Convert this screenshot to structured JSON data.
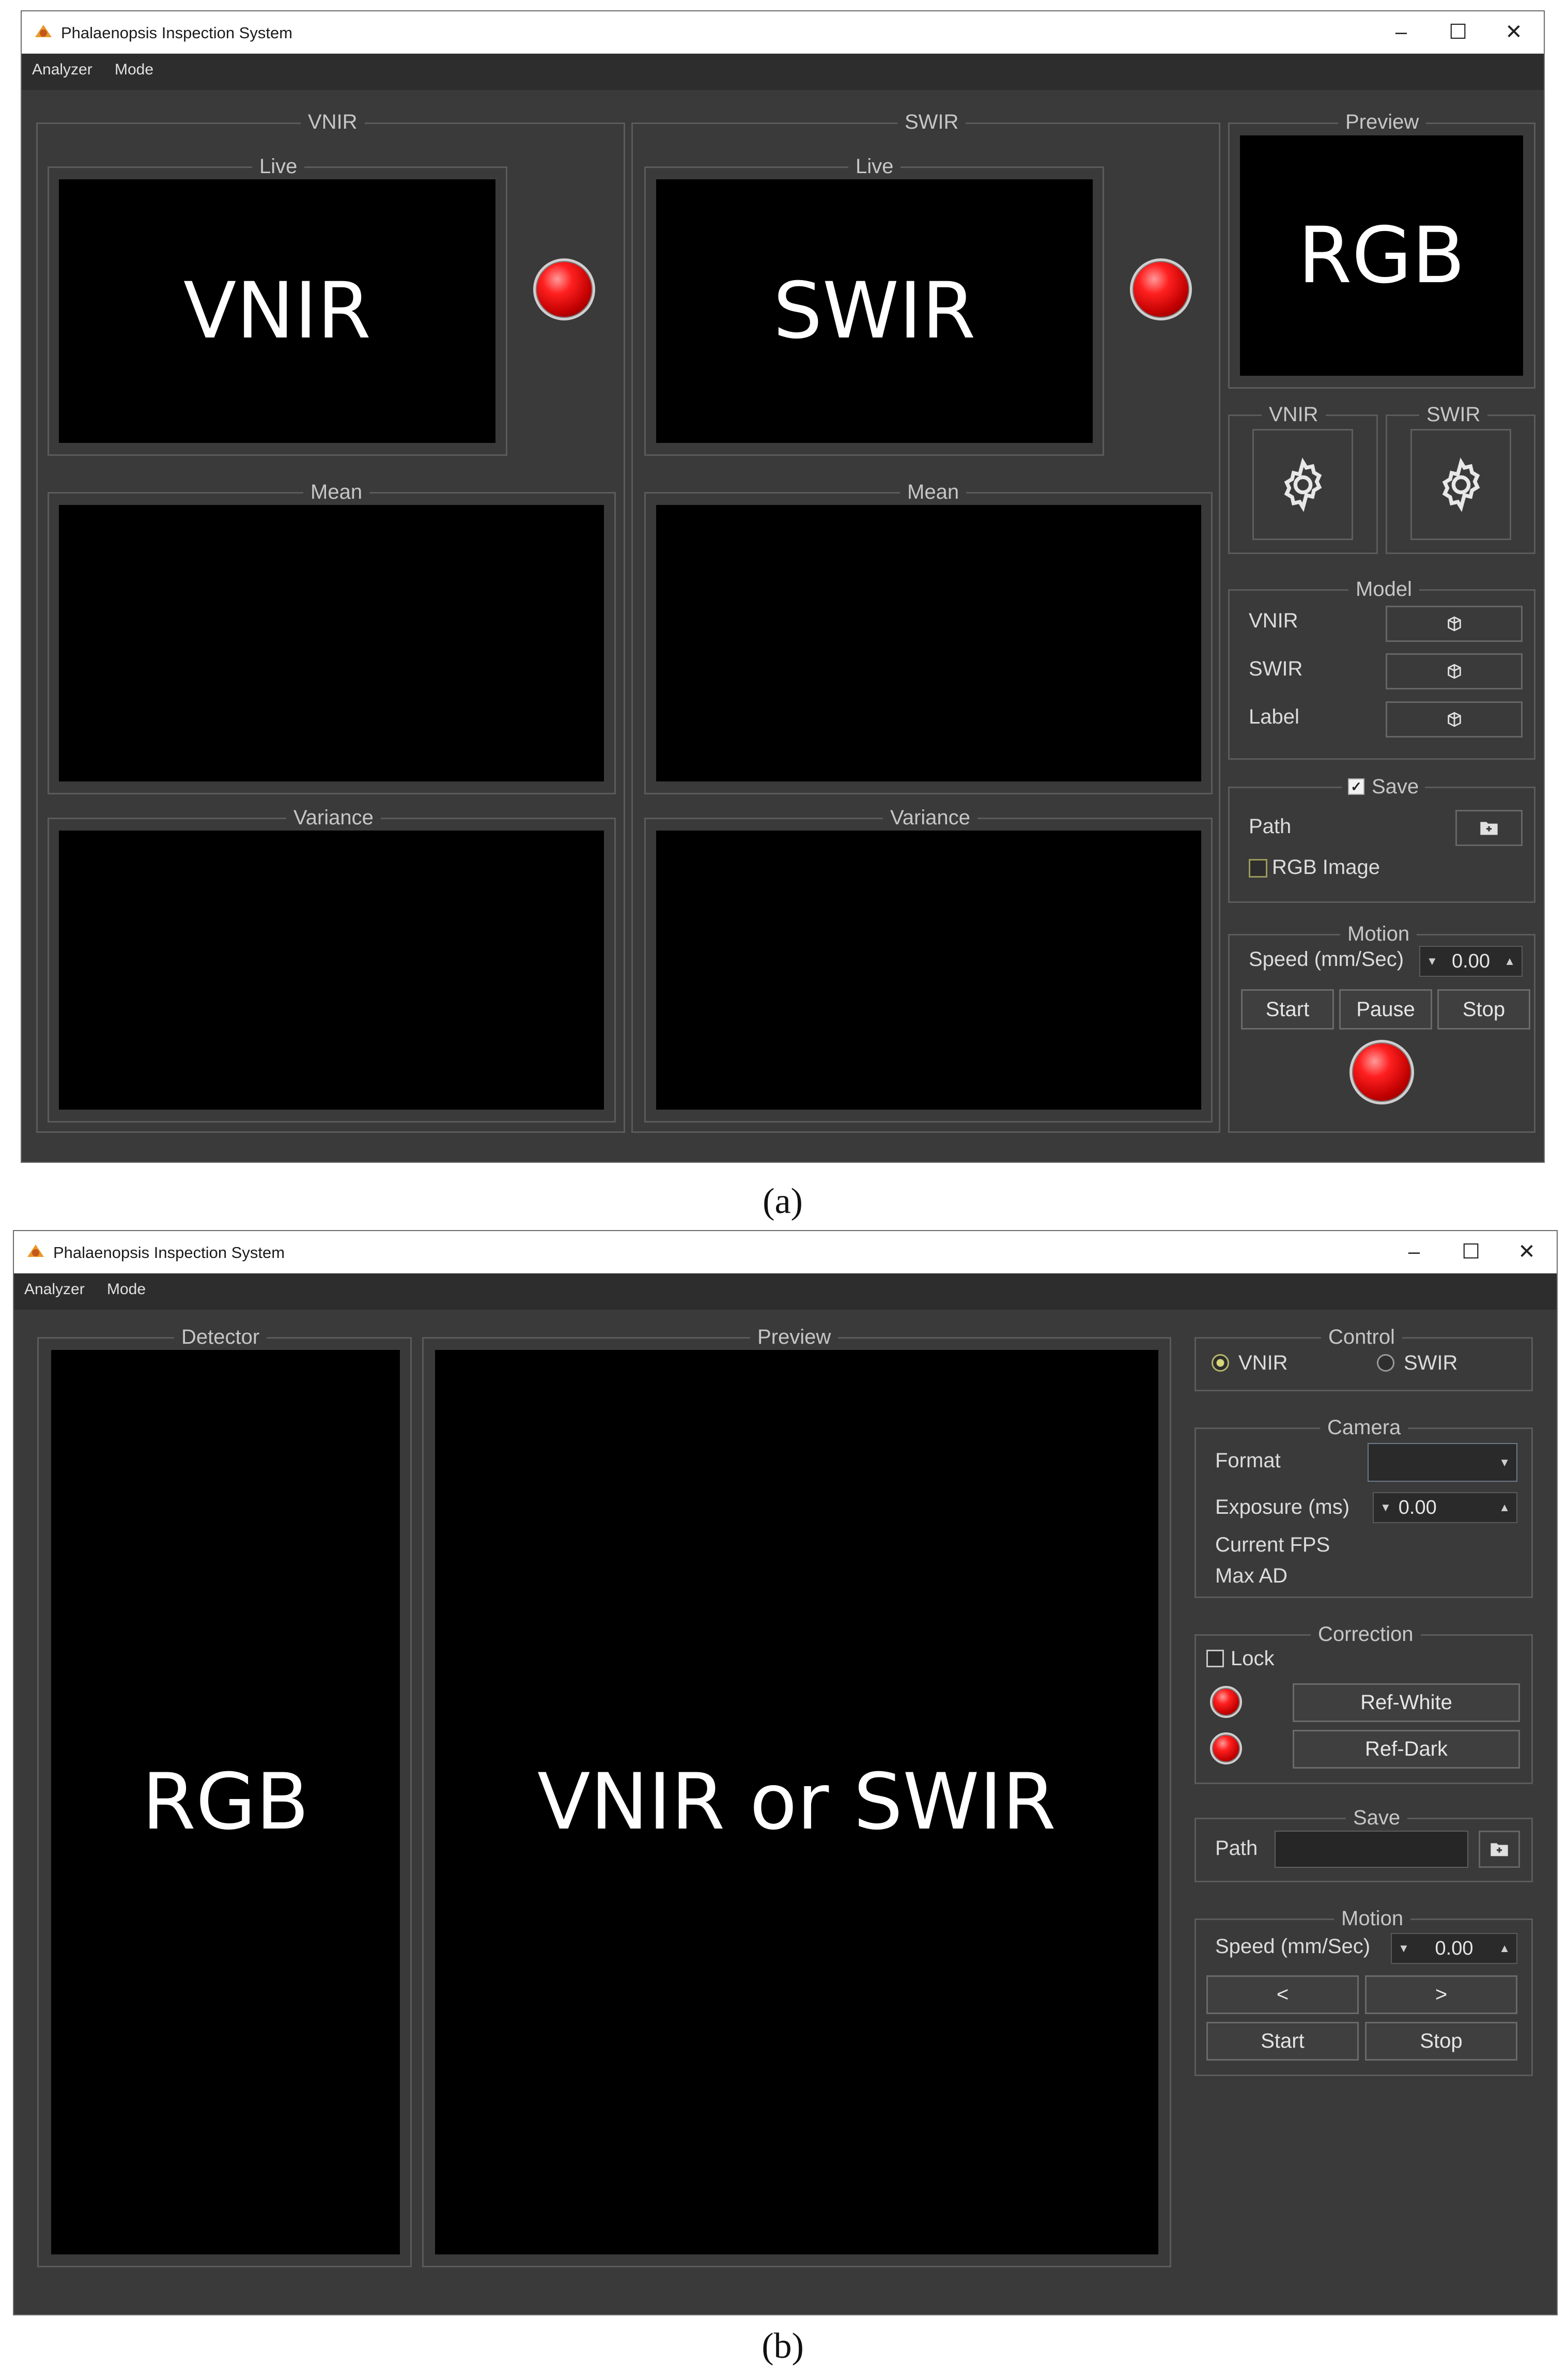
{
  "app_title": "Phalaenopsis Inspection System",
  "window_controls": {
    "minimize": "–",
    "maximize": "☐",
    "close": "✕"
  },
  "menu": {
    "analyzer": "Analyzer",
    "mode": "Mode"
  },
  "captions": {
    "a": "(a)",
    "b": "(b)"
  },
  "screen_a": {
    "vnir": {
      "title": "VNIR",
      "live": "Live",
      "live_label": "VNIR",
      "mean": "Mean",
      "variance": "Variance"
    },
    "swir": {
      "title": "SWIR",
      "live": "Live",
      "live_label": "SWIR",
      "mean": "Mean",
      "variance": "Variance"
    },
    "preview": {
      "title": "Preview",
      "label": "RGB"
    },
    "settings": {
      "vnir": "VNIR",
      "swir": "SWIR"
    },
    "model": {
      "title": "Model",
      "rows": [
        "VNIR",
        "SWIR",
        "Label"
      ]
    },
    "save": {
      "title": "Save",
      "checked": true,
      "path": "Path",
      "rgb_image": "RGB Image",
      "rgb_image_checked": false
    },
    "motion": {
      "title": "Motion",
      "speed_label": "Speed (mm/Sec)",
      "speed_value": "0.00",
      "start": "Start",
      "pause": "Pause",
      "stop": "Stop"
    },
    "led_color": "#e00000"
  },
  "screen_b": {
    "detector": {
      "title": "Detector",
      "label": "RGB"
    },
    "preview": {
      "title": "Preview",
      "label": "VNIR or SWIR"
    },
    "control": {
      "title": "Control",
      "vnir": "VNIR",
      "swir": "SWIR",
      "selected": "VNIR"
    },
    "camera": {
      "title": "Camera",
      "format": "Format",
      "exposure": "Exposure (ms)",
      "exposure_value": "0.00",
      "current_fps": "Current FPS",
      "max_ad": "Max AD"
    },
    "correction": {
      "title": "Correction",
      "lock": "Lock",
      "ref_white": "Ref-White",
      "ref_dark": "Ref-Dark"
    },
    "save": {
      "title": "Save",
      "path": "Path"
    },
    "motion": {
      "title": "Motion",
      "speed_label": "Speed (mm/Sec)",
      "speed_value": "0.00",
      "left": "<",
      "right": ">",
      "start": "Start",
      "stop": "Stop"
    }
  },
  "colors": {
    "window_bg": "#3a3a3a",
    "panel_black": "#000000",
    "border": "#5b5b5b",
    "led": "#e00000"
  }
}
